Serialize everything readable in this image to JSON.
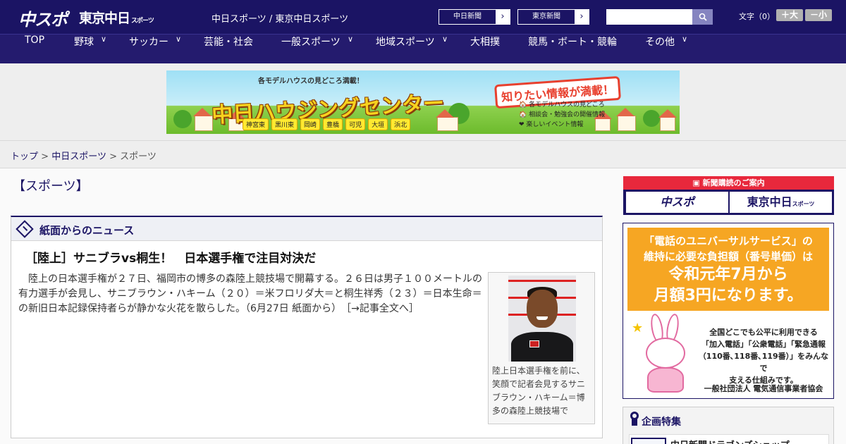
{
  "header": {
    "logo_chuspo": "中スポ",
    "logo_tokyo": "東京中日",
    "logo_tokyo_sub": "スポーツ",
    "site_links": "中日スポーツ / 東京中日スポーツ",
    "btn_chunichi": "中日新聞",
    "btn_tokyo": "東京新聞",
    "font_size_label": "文字（0）",
    "font_large": "＋大",
    "font_small": "－小",
    "accent_color": "#1b1464"
  },
  "nav": {
    "items": [
      "TOP",
      "野球",
      "サッカー",
      "芸能・社会",
      "一般スポーツ",
      "地域スポーツ",
      "大相撲",
      "競馬・ボート・競輪",
      "その他"
    ]
  },
  "ad": {
    "top_text": "各モデルハウスの見どころ満載！",
    "title": "中日ハウジングセンター",
    "bubble": "知りたい情報が満載！",
    "list": [
      "各モデルハウスの見どころ",
      "相談会・勉強会の開催情報",
      "楽しいイベント情報"
    ],
    "cities": [
      "神宮東",
      "黒川東",
      "岡崎",
      "豊橋",
      "可児",
      "大垣",
      "浜北"
    ]
  },
  "breadcrumb": {
    "top": "トップ",
    "sep": ">",
    "parent": "中日スポーツ",
    "current": "スポーツ"
  },
  "page": {
    "category_title": "【スポーツ】"
  },
  "news": {
    "section_title": "紙面からのニュース",
    "article_title": "［陸上］サニブラvs桐生！　日本選手権で注目対決だ",
    "article_body": "陸上の日本選手権が２７日、福岡市の博多の森陸上競技場で開幕する。２６日は男子１００メートルの有力選手が会見し、サニブラウン・ハキーム（２０）＝米フロリダ大＝と桐生祥秀（２３）＝日本生命＝の新旧日本記録保持者らが静かな火花を散らした。（6月27日 紙面から）",
    "read_more": "［→記事全文へ］",
    "photo_caption": "陸上日本選手権を前に、笑顔で記者会見するサニブラウン・ハキーム＝博多の森陸上競技場で"
  },
  "sidebar": {
    "subscribe_head": "新聞購読のご案内",
    "subscribe_chuspo": "中スポ",
    "subscribe_tokyo": "東京中日",
    "subscribe_tokyo_sub": "スポーツ",
    "universal_line1": "「電話のユニバーサルサービス」の",
    "universal_line2": "維持に必要な負担額（番号単価）は",
    "universal_big1": "令和元年7月から",
    "universal_big2": "月額3円になります。",
    "universal_text1": "全国どこでも公平に利用できる",
    "universal_text2": "「加入電話」「公衆電話」「緊急通報",
    "universal_text3": "（110番､118番､119番）」をみんなで",
    "universal_text4": "支える仕組みです。",
    "universal_org": "一般社団法人 電気通信事業者協会",
    "feature_title": "企画特集",
    "feature_item": "中日新聞ドラゴンズショップ"
  }
}
